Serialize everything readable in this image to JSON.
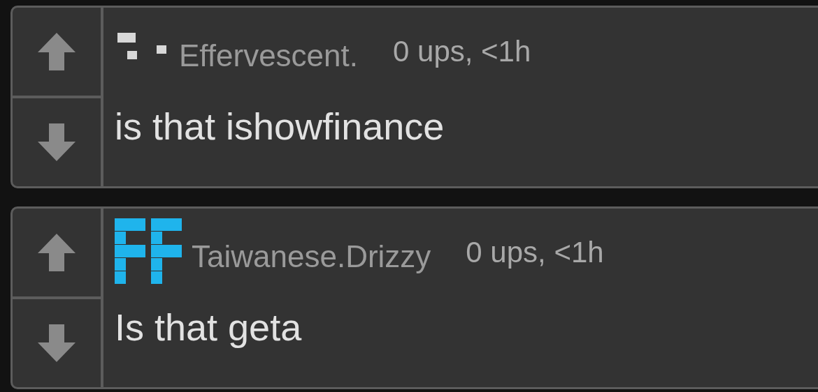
{
  "comments": [
    {
      "kind": "dots",
      "username": "Effervescent.",
      "meta": "0 ups, <1h",
      "text": "is that ishowfinance"
    },
    {
      "kind": "blocks",
      "username": "Taiwanese.Drizzy",
      "meta": "0 ups, <1h",
      "text": "Is that geta"
    }
  ]
}
